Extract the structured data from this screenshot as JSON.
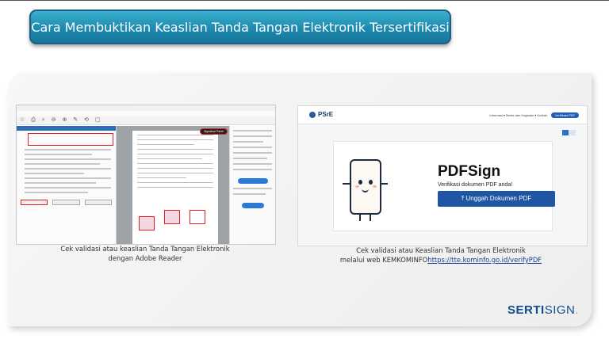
{
  "title": "Cara Membuktikan Keaslian Tanda Tangan Elektronik Tersertifikasi",
  "adobe_shot": {
    "signature_panel_button": "Signature Panel",
    "caption_line1": "Cek validasi atau keaslian Tanda Tangan Elektronik",
    "caption_line2": "dengan Adobe Reader"
  },
  "psre_shot": {
    "logo": "PSrE",
    "nav": "Informasi ▾   Berita dan Kegiatan ▾   Kontak",
    "nav_button": "Verifikasi PDF",
    "heading": "PDFSign",
    "subtitle": "Verifikasi dokumen PDF anda!",
    "upload_button": "⤒ Unggah Dokumen PDF",
    "caption_line1": "Cek validasi atau Keaslian Tanda Tangan Elektronik",
    "caption_prefix": "melalui web KEMKOMINFO",
    "caption_link": "https://tte.kominfo.go.id/verifyPDF"
  },
  "brand": {
    "part1": "SERTI",
    "part2": "SIGN",
    "part3": "."
  },
  "colors": {
    "banner": "#1d8ab0",
    "brand": "#0f4d8e",
    "upload": "#1e56a5",
    "highlight": "#dd2222"
  }
}
